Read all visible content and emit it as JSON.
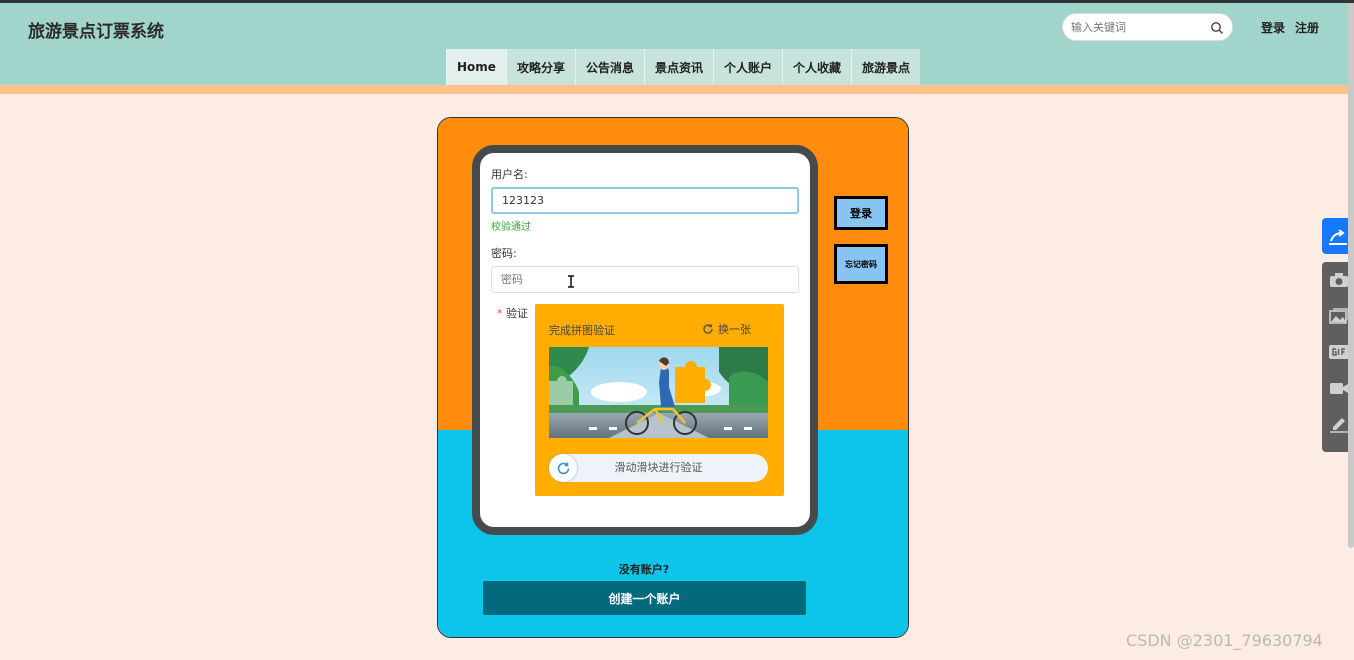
{
  "header": {
    "site_title": "旅游景点订票系统",
    "search_placeholder": "输入关键词",
    "login_link": "登录",
    "register_link": "注册"
  },
  "nav": {
    "items": [
      "Home",
      "攻略分享",
      "公告消息",
      "景点资讯",
      "个人账户",
      "个人收藏",
      "旅游景点"
    ],
    "active": "Home"
  },
  "login_form": {
    "username_label": "用户名:",
    "username_value": "123123",
    "username_status": "校验通过",
    "password_label": "密码:",
    "password_placeholder": "密码",
    "verify_label": "验证",
    "login_button": "登录",
    "forgot_button": "忘记密码",
    "no_account_text": "没有账户?",
    "create_account_button": "创建一个账户"
  },
  "captcha": {
    "title": "完成拼图验证",
    "refresh_label": "换一张",
    "slider_text": "滑动滑块进行验证"
  },
  "watermark": "CSDN @2301_79630794",
  "colors": {
    "header_bg": "#a1d5cb",
    "page_bg": "#fdece4",
    "panel_top": "#ff8c0d",
    "panel_bottom": "#0dc5ea",
    "captcha_bg": "#ffad00",
    "create_button": "#036a7d",
    "side_button": "#87c4ef",
    "status_ok": "#3aa040"
  },
  "side_tools": [
    "share-icon",
    "camera-icon",
    "image-icon",
    "gif-icon",
    "video-icon",
    "pen-icon"
  ]
}
